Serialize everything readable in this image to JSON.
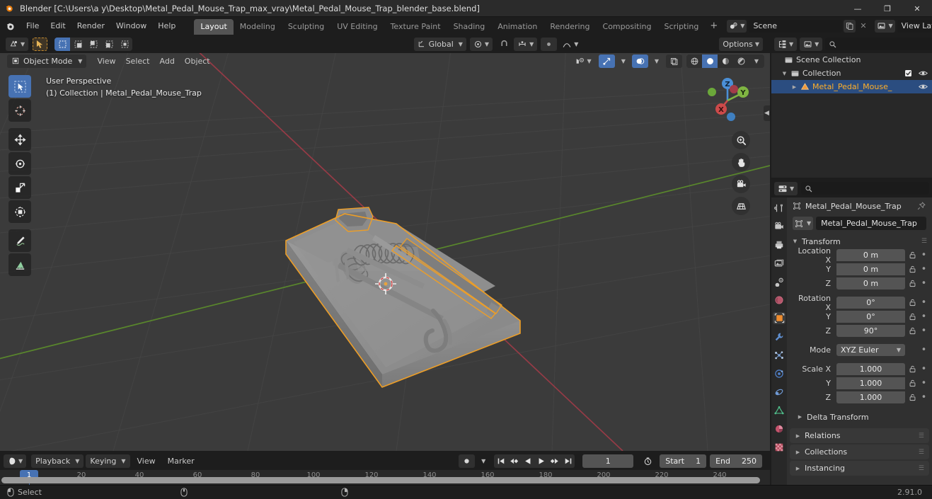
{
  "window": {
    "title": "Blender [C:\\Users\\a y\\Desktop\\Metal_Pedal_Mouse_Trap_max_vray\\Metal_Pedal_Mouse_Trap_blender_base.blend]",
    "minimize": "—",
    "maximize": "❐",
    "close": "✕"
  },
  "topbar": {
    "menus": [
      "File",
      "Edit",
      "Render",
      "Window",
      "Help"
    ],
    "workspaces": [
      {
        "label": "Layout",
        "active": true
      },
      {
        "label": "Modeling",
        "active": false
      },
      {
        "label": "Sculpting",
        "active": false
      },
      {
        "label": "UV Editing",
        "active": false
      },
      {
        "label": "Texture Paint",
        "active": false
      },
      {
        "label": "Shading",
        "active": false
      },
      {
        "label": "Animation",
        "active": false
      },
      {
        "label": "Rendering",
        "active": false
      },
      {
        "label": "Compositing",
        "active": false
      },
      {
        "label": "Scripting",
        "active": false
      }
    ],
    "add_workspace": "+",
    "scene_name": "Scene",
    "view_layer_name": "View Layer"
  },
  "viewport": {
    "mode": "Object Mode",
    "menus": [
      "View",
      "Select",
      "Add",
      "Object"
    ],
    "transform_orientation": "Global",
    "options_label": "Options",
    "overlay_line1": "User Perspective",
    "overlay_line2": "(1) Collection | Metal_Pedal_Mouse_Trap",
    "gizmo_axes": [
      "X",
      "Y",
      "Z"
    ],
    "background_color": "#3b3b3b",
    "selection_outline_color": "#ed9e27"
  },
  "outliner": {
    "search_placeholder": "",
    "rows": [
      {
        "label": "Scene Collection",
        "indent": 0,
        "selected": false,
        "has_tri": false,
        "checkbox": false,
        "eye": false
      },
      {
        "label": "Collection",
        "indent": 1,
        "selected": false,
        "has_tri": true,
        "checkbox": true,
        "eye": true
      },
      {
        "label": "Metal_Pedal_Mouse_",
        "indent": 2,
        "selected": true,
        "has_tri": true,
        "checkbox": false,
        "eye": true
      }
    ]
  },
  "properties": {
    "search_placeholder": "",
    "breadcrumb_object": "Metal_Pedal_Mouse_Trap",
    "object_name": "Metal_Pedal_Mouse_Trap",
    "transform_title": "Transform",
    "location": {
      "label": "Location X",
      "x": "0 m",
      "y": "0 m",
      "z": "0 m",
      "y_label": "Y",
      "z_label": "Z"
    },
    "rotation": {
      "label": "Rotation X",
      "x": "0°",
      "y": "0°",
      "z": "90°",
      "y_label": "Y",
      "z_label": "Z"
    },
    "mode": {
      "label": "Mode",
      "value": "XYZ Euler"
    },
    "scale": {
      "label": "Scale X",
      "x": "1.000",
      "y": "1.000",
      "z": "1.000",
      "y_label": "Y",
      "z_label": "Z"
    },
    "subpanels": [
      "Delta Transform"
    ],
    "panels": [
      "Relations",
      "Collections",
      "Instancing"
    ],
    "tabs": [
      "tool-icon",
      "render-icon",
      "output-icon",
      "view-layer-icon",
      "scene-icon",
      "world-icon",
      "object-icon",
      "modifier-icon",
      "particles-icon",
      "physics-icon",
      "constraint-icon",
      "data-icon",
      "material-icon",
      "texture-icon"
    ],
    "active_tab": "object-icon"
  },
  "timeline": {
    "menus": [
      "Playback",
      "Keying",
      "View",
      "Marker"
    ],
    "current_frame": "1",
    "start_label": "Start",
    "start_value": "1",
    "end_label": "End",
    "end_value": "250",
    "ticks": [
      "20",
      "40",
      "60",
      "80",
      "100",
      "120",
      "140",
      "160",
      "180",
      "200",
      "220",
      "240"
    ],
    "playhead_frame": "1"
  },
  "statusbar": {
    "select_label": "Select",
    "version": "2.91.0"
  }
}
